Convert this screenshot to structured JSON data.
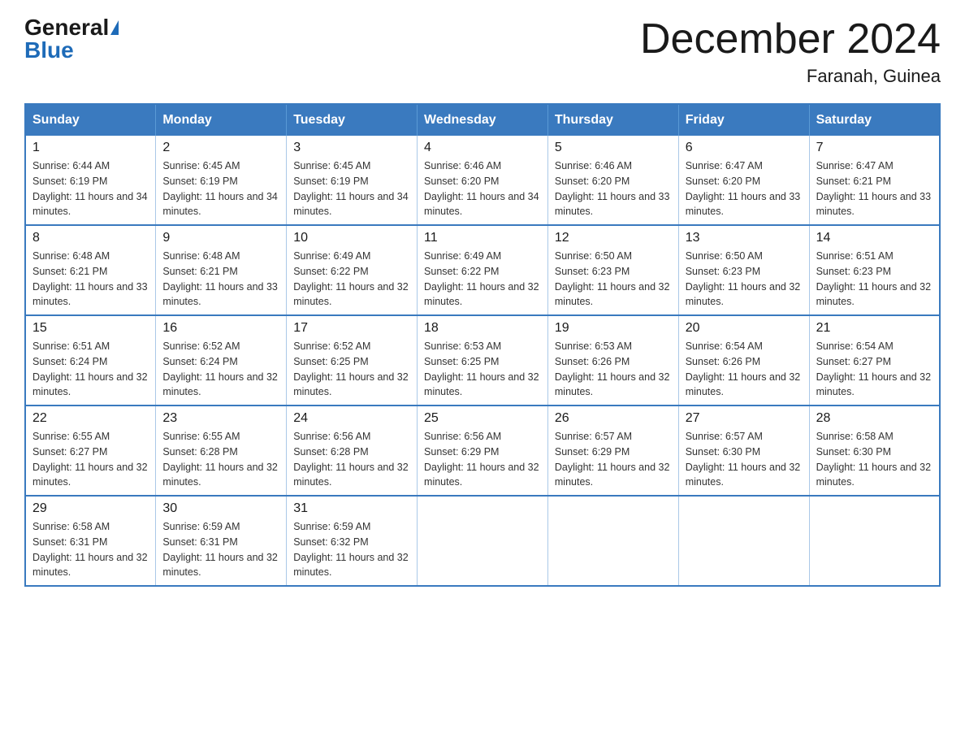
{
  "logo": {
    "general": "General",
    "blue": "Blue"
  },
  "title": "December 2024",
  "subtitle": "Faranah, Guinea",
  "days_of_week": [
    "Sunday",
    "Monday",
    "Tuesday",
    "Wednesday",
    "Thursday",
    "Friday",
    "Saturday"
  ],
  "weeks": [
    [
      {
        "date": "1",
        "sunrise": "6:44 AM",
        "sunset": "6:19 PM",
        "daylight": "11 hours and 34 minutes."
      },
      {
        "date": "2",
        "sunrise": "6:45 AM",
        "sunset": "6:19 PM",
        "daylight": "11 hours and 34 minutes."
      },
      {
        "date": "3",
        "sunrise": "6:45 AM",
        "sunset": "6:19 PM",
        "daylight": "11 hours and 34 minutes."
      },
      {
        "date": "4",
        "sunrise": "6:46 AM",
        "sunset": "6:20 PM",
        "daylight": "11 hours and 34 minutes."
      },
      {
        "date": "5",
        "sunrise": "6:46 AM",
        "sunset": "6:20 PM",
        "daylight": "11 hours and 33 minutes."
      },
      {
        "date": "6",
        "sunrise": "6:47 AM",
        "sunset": "6:20 PM",
        "daylight": "11 hours and 33 minutes."
      },
      {
        "date": "7",
        "sunrise": "6:47 AM",
        "sunset": "6:21 PM",
        "daylight": "11 hours and 33 minutes."
      }
    ],
    [
      {
        "date": "8",
        "sunrise": "6:48 AM",
        "sunset": "6:21 PM",
        "daylight": "11 hours and 33 minutes."
      },
      {
        "date": "9",
        "sunrise": "6:48 AM",
        "sunset": "6:21 PM",
        "daylight": "11 hours and 33 minutes."
      },
      {
        "date": "10",
        "sunrise": "6:49 AM",
        "sunset": "6:22 PM",
        "daylight": "11 hours and 32 minutes."
      },
      {
        "date": "11",
        "sunrise": "6:49 AM",
        "sunset": "6:22 PM",
        "daylight": "11 hours and 32 minutes."
      },
      {
        "date": "12",
        "sunrise": "6:50 AM",
        "sunset": "6:23 PM",
        "daylight": "11 hours and 32 minutes."
      },
      {
        "date": "13",
        "sunrise": "6:50 AM",
        "sunset": "6:23 PM",
        "daylight": "11 hours and 32 minutes."
      },
      {
        "date": "14",
        "sunrise": "6:51 AM",
        "sunset": "6:23 PM",
        "daylight": "11 hours and 32 minutes."
      }
    ],
    [
      {
        "date": "15",
        "sunrise": "6:51 AM",
        "sunset": "6:24 PM",
        "daylight": "11 hours and 32 minutes."
      },
      {
        "date": "16",
        "sunrise": "6:52 AM",
        "sunset": "6:24 PM",
        "daylight": "11 hours and 32 minutes."
      },
      {
        "date": "17",
        "sunrise": "6:52 AM",
        "sunset": "6:25 PM",
        "daylight": "11 hours and 32 minutes."
      },
      {
        "date": "18",
        "sunrise": "6:53 AM",
        "sunset": "6:25 PM",
        "daylight": "11 hours and 32 minutes."
      },
      {
        "date": "19",
        "sunrise": "6:53 AM",
        "sunset": "6:26 PM",
        "daylight": "11 hours and 32 minutes."
      },
      {
        "date": "20",
        "sunrise": "6:54 AM",
        "sunset": "6:26 PM",
        "daylight": "11 hours and 32 minutes."
      },
      {
        "date": "21",
        "sunrise": "6:54 AM",
        "sunset": "6:27 PM",
        "daylight": "11 hours and 32 minutes."
      }
    ],
    [
      {
        "date": "22",
        "sunrise": "6:55 AM",
        "sunset": "6:27 PM",
        "daylight": "11 hours and 32 minutes."
      },
      {
        "date": "23",
        "sunrise": "6:55 AM",
        "sunset": "6:28 PM",
        "daylight": "11 hours and 32 minutes."
      },
      {
        "date": "24",
        "sunrise": "6:56 AM",
        "sunset": "6:28 PM",
        "daylight": "11 hours and 32 minutes."
      },
      {
        "date": "25",
        "sunrise": "6:56 AM",
        "sunset": "6:29 PM",
        "daylight": "11 hours and 32 minutes."
      },
      {
        "date": "26",
        "sunrise": "6:57 AM",
        "sunset": "6:29 PM",
        "daylight": "11 hours and 32 minutes."
      },
      {
        "date": "27",
        "sunrise": "6:57 AM",
        "sunset": "6:30 PM",
        "daylight": "11 hours and 32 minutes."
      },
      {
        "date": "28",
        "sunrise": "6:58 AM",
        "sunset": "6:30 PM",
        "daylight": "11 hours and 32 minutes."
      }
    ],
    [
      {
        "date": "29",
        "sunrise": "6:58 AM",
        "sunset": "6:31 PM",
        "daylight": "11 hours and 32 minutes."
      },
      {
        "date": "30",
        "sunrise": "6:59 AM",
        "sunset": "6:31 PM",
        "daylight": "11 hours and 32 minutes."
      },
      {
        "date": "31",
        "sunrise": "6:59 AM",
        "sunset": "6:32 PM",
        "daylight": "11 hours and 32 minutes."
      },
      null,
      null,
      null,
      null
    ]
  ]
}
